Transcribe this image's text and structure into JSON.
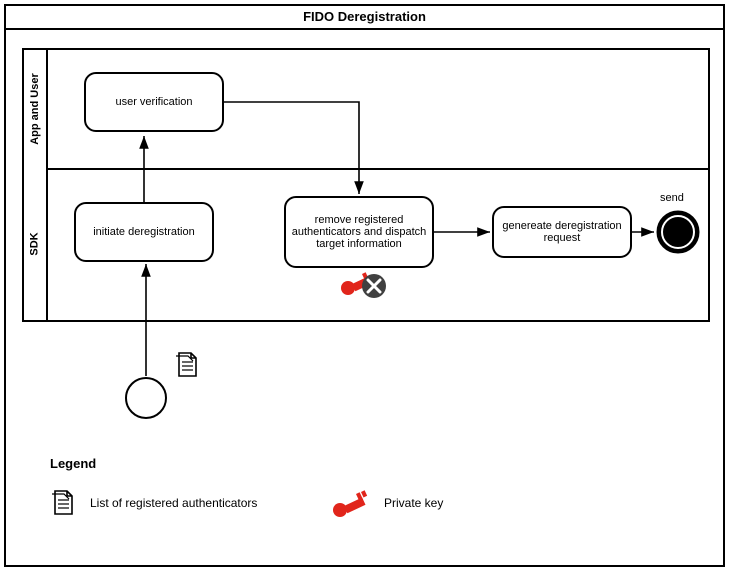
{
  "title": "FIDO Deregistration",
  "lanes": {
    "top": "App and User",
    "bottom": "SDK"
  },
  "tasks": {
    "user_verification": "user verification",
    "initiate": "initiate deregistration",
    "remove": "remove registered authenticators and dispatch target information",
    "generate": "genereate deregistration request"
  },
  "end_label": "send",
  "legend": {
    "title": "Legend",
    "item1": "List of registered authenticators",
    "item2": "Private key"
  },
  "icons": {
    "document": "document-icon",
    "key": "key-icon",
    "key_delete": "key-delete-icon",
    "end_event": "end-event-icon",
    "start_event": "start-event-icon"
  }
}
